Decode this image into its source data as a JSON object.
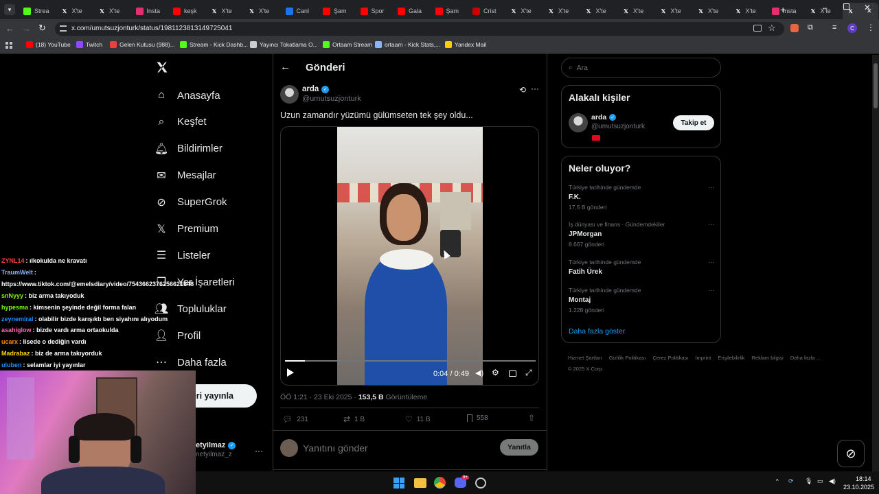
{
  "browser": {
    "tabs": [
      {
        "label": "Strea",
        "icon": "kick-icon",
        "color": "#53fc18"
      },
      {
        "label": "X'te",
        "icon": "x-icon",
        "color": "#000000"
      },
      {
        "label": "X'te",
        "icon": "x-icon",
        "color": "#000000"
      },
      {
        "label": "Insta",
        "icon": "instagram-icon",
        "color": "#e1306c"
      },
      {
        "label": "keşk",
        "icon": "youtube-icon",
        "color": "#ff0000"
      },
      {
        "label": "X'te",
        "icon": "x-icon",
        "color": "#000000"
      },
      {
        "label": "X'te",
        "icon": "x-icon",
        "color": "#000000"
      },
      {
        "label": "Canl",
        "icon": "m-icon",
        "color": "#1a73e8"
      },
      {
        "label": "Şam",
        "icon": "youtube-icon",
        "color": "#ff0000"
      },
      {
        "label": "Spor",
        "icon": "youtube-icon",
        "color": "#ff0000"
      },
      {
        "label": "Gala",
        "icon": "youtube-icon",
        "color": "#ff0000"
      },
      {
        "label": "Şam",
        "icon": "youtube-icon",
        "color": "#ff0000"
      },
      {
        "label": "Crist",
        "icon": "cnn-icon",
        "color": "#cc0000"
      },
      {
        "label": "X'te",
        "icon": "x-icon",
        "color": "#000000"
      },
      {
        "label": "X'te",
        "icon": "x-icon",
        "color": "#000000"
      },
      {
        "label": "X'te",
        "icon": "x-icon",
        "color": "#000000"
      },
      {
        "label": "X'te",
        "icon": "x-icon",
        "color": "#000000"
      },
      {
        "label": "X'te",
        "icon": "x-icon",
        "color": "#000000"
      },
      {
        "label": "X'te",
        "icon": "x-icon",
        "color": "#000000"
      },
      {
        "label": "X'te",
        "icon": "x-icon",
        "color": "#000000"
      },
      {
        "label": "Insta",
        "icon": "instagram-icon",
        "color": "#e1306c"
      },
      {
        "label": "X'te",
        "icon": "x-icon",
        "color": "#000000"
      },
      {
        "label": "",
        "icon": "x-icon",
        "color": "#000000",
        "active": true
      }
    ],
    "url": "x.com/umutsuzjonturk/status/1981123813149725041",
    "bookmarks": [
      {
        "label": "(18) YouTube",
        "color": "#ff0000"
      },
      {
        "label": "Twitch",
        "color": "#9146ff"
      },
      {
        "label": "Gelen Kutusu (988)...",
        "color": "#ea4335"
      },
      {
        "label": "Stream - Kick Dashb...",
        "color": "#53fc18"
      },
      {
        "label": "Yayıncı Tokatlama O...",
        "color": "#cccccc"
      },
      {
        "label": "Ortaam Stream",
        "color": "#53fc18"
      },
      {
        "label": "ortaam - Kick Stats,...",
        "color": "#8ab4f8"
      },
      {
        "label": "Yandex Mail",
        "color": "#ffcc00"
      }
    ]
  },
  "nav": {
    "items": [
      {
        "label": "Anasayfa",
        "icon": "home-icon"
      },
      {
        "label": "Keşfet",
        "icon": "search-icon"
      },
      {
        "label": "Bildirimler",
        "icon": "bell-icon"
      },
      {
        "label": "Mesajlar",
        "icon": "mail-icon"
      },
      {
        "label": "SuperGrok",
        "icon": "grok-icon"
      },
      {
        "label": "Premium",
        "icon": "x-icon"
      },
      {
        "label": "Listeler",
        "icon": "list-icon"
      },
      {
        "label": "Yer İşaretleri",
        "icon": "bookmark-icon"
      },
      {
        "label": "Topluluklar",
        "icon": "people-icon"
      },
      {
        "label": "Profil",
        "icon": "person-icon"
      },
      {
        "label": "Daha fazla",
        "icon": "more-circle-icon"
      }
    ],
    "post_button": "eri yayınla",
    "account_name": "etyilmaz",
    "account_handle": "netyilmaz_z"
  },
  "post": {
    "header": "Gönderi",
    "author_name": "arda",
    "author_handle": "@umutsuzjonturk",
    "text": "Uzun zamandır yüzümü gülümseten tek şey oldu...",
    "video_time": "0:04 / 0:49",
    "video_progress": 0.08,
    "time": "ÖÖ 1:21 · 23 Eki 2025 · ",
    "views_count": "153,5 B",
    "views_label": " Görüntüleme",
    "replies": "231",
    "reposts": "1 B",
    "likes": "11 B",
    "bookmarks": "558",
    "reply_placeholder": "Yanıtını gönder",
    "reply_button": "Yanıtla"
  },
  "sidebar": {
    "search_placeholder": "Ara",
    "relevant_title": "Alakalı kişiler",
    "relevant_name": "arda",
    "relevant_handle": "@umutsuzjonturk",
    "follow_button": "Takip et",
    "trends_title": "Neler oluyor?",
    "trends": [
      {
        "context": "Türkiye tarihinde gündemde",
        "name": "F.K.",
        "count": "17,5 B gönderi"
      },
      {
        "context": "İş dünyası ve finans · Gündemdekiler",
        "name": "JPMorgan",
        "count": "8.667 gönderi"
      },
      {
        "context": "Türkiye tarihinde gündemde",
        "name": "Fatih Ürek",
        "count": ""
      },
      {
        "context": "Türkiye tarihinde gündemde",
        "name": "Montaj",
        "count": "1.228 gönderi"
      }
    ],
    "show_more": "Daha fazla göster",
    "footer_links": [
      "Hizmet Şartları",
      "Gizlilik Politikası",
      "Çerez Politikası",
      "Imprint",
      "Erişilebilirlik",
      "Reklam bilgisi",
      "Daha fazla ..."
    ],
    "copyright": "© 2025 X Corp."
  },
  "chat": [
    {
      "user": "ZYNL14",
      "color": "#ff3b3b",
      "msg": ": ılkokulda ne kravatı"
    },
    {
      "user": "TraumWelt",
      "color": "#8ab4f8",
      "msg": ":"
    },
    {
      "user": "",
      "color": "#ffffff",
      "msg": "https://www.tiktok.com/@emelsdiary/video/7543662376256621848"
    },
    {
      "user": "snNyyy",
      "color": "#7cfc00",
      "msg": ": biz arma takıyoduk"
    },
    {
      "user": "hypesma",
      "color": "#7cfc00",
      "msg": ": kimsenin şeyinde değil forma falan"
    },
    {
      "user": "zeynemiral",
      "color": "#1e90ff",
      "msg": ": olabilir bizde karışıktı ben siyahını alıyodum"
    },
    {
      "user": "asahiglow",
      "color": "#ff69b4",
      "msg": ": bizde vardı arma ortaokulda"
    },
    {
      "user": "ucarx",
      "color": "#ff8c00",
      "msg": ": lisede o dediğin vardı"
    },
    {
      "user": "Madrabaz",
      "color": "#ffd700",
      "msg": ": biz de arma takıyorduk"
    },
    {
      "user": "uluben",
      "color": "#1e90ff",
      "msg": ": selamlar iyi yayınlar"
    }
  ],
  "taskbar": {
    "time": "18:14",
    "date": "23.10.2025",
    "discord_badge": "9+"
  }
}
